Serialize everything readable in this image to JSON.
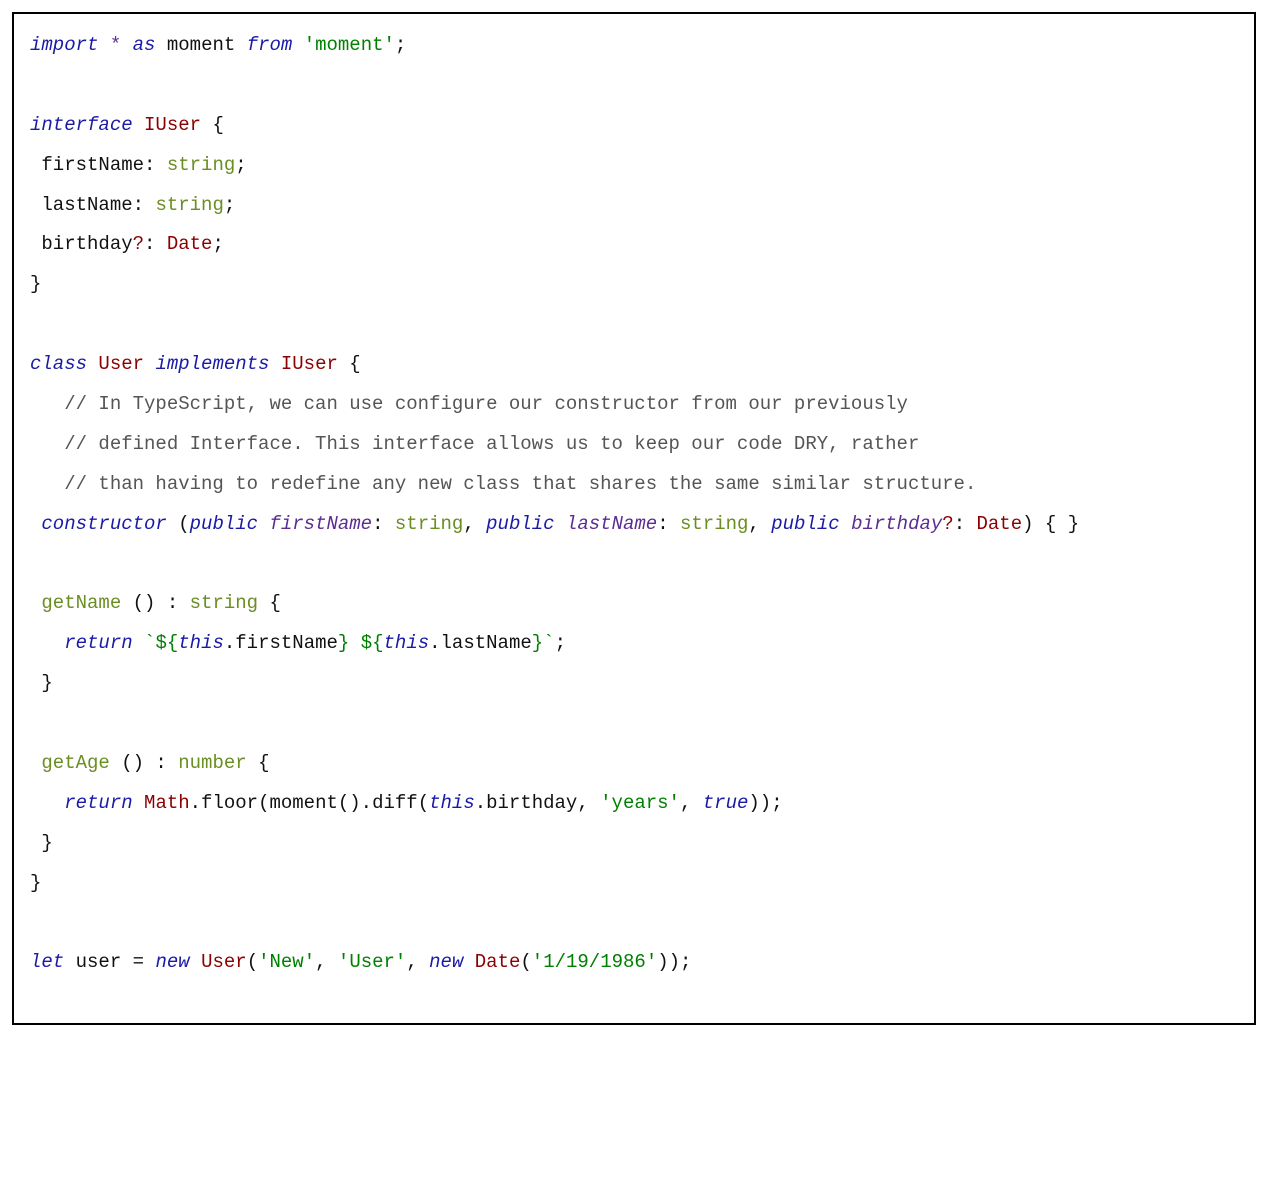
{
  "code": {
    "l1": {
      "import": "import",
      "star": "*",
      "as": "as",
      "moment": "moment",
      "from": "from",
      "str": "'moment'",
      "end": ";"
    },
    "l2": "",
    "l3": {
      "interface": "interface",
      "name": "IUser",
      "brace": " {"
    },
    "l4": {
      "indent": " ",
      "prop": "firstName",
      "colon": ": ",
      "type": "string",
      "end": ";"
    },
    "l5": {
      "indent": " ",
      "prop": "lastName",
      "colon": ": ",
      "type": "string",
      "end": ";"
    },
    "l6": {
      "indent": " ",
      "prop": "birthday",
      "q": "?",
      "colon": ": ",
      "type": "Date",
      "end": ";"
    },
    "l7": "}",
    "l8": "",
    "l9": {
      "class": "class",
      "name": "User",
      "implements": "implements",
      "iname": "IUser",
      "brace": " {"
    },
    "l10": "   // In TypeScript, we can use configure our constructor from our previously",
    "l11": "   // defined Interface. This interface allows us to keep our code DRY, rather",
    "l12": "   // than having to redefine any new class that shares the same similar structure.",
    "l13": {
      "indent": " ",
      "constructor": "constructor",
      "open": " (",
      "p1k": "public",
      "p1n": "firstName",
      "p1c": ": ",
      "p1t": "string",
      "c1": ", ",
      "p2k": "public",
      "p2n": "lastName",
      "p2c": ": ",
      "p2t": "string",
      "c2": ", ",
      "p3k": "public",
      "p3n": "birthday",
      "p3q": "?",
      "p3c": ": ",
      "p3t": "Date",
      "close": ") { }"
    },
    "l14": "",
    "l15": {
      "indent": " ",
      "name": "getName",
      "sig": " () : ",
      "type": "string",
      "brace": " {"
    },
    "l16": {
      "indent": "   ",
      "return": "return",
      "sp": " ",
      "s1": "`${",
      "e1": "this",
      "e1b": ".firstName",
      "s2": "} ${",
      "e2": "this",
      "e2b": ".lastName",
      "s3": "}`",
      "end": ";"
    },
    "l17": " }",
    "l18": "",
    "l19": {
      "indent": " ",
      "name": "getAge",
      "sig": " () : ",
      "type": "number",
      "brace": " {"
    },
    "l20": {
      "indent": "   ",
      "return": "return",
      "sp": " ",
      "math": "Math",
      "rest1": ".floor(moment().diff(",
      "this": "this",
      "rest2": ".birthday, ",
      "str": "'years'",
      "rest3": ", ",
      "true": "true",
      "rest4": "));"
    },
    "l21": " }",
    "l22": "}",
    "l23": "",
    "l24": {
      "let": "let",
      "sp": " ",
      "var": "user",
      "eq": " = ",
      "new1": "new",
      "sp2": " ",
      "cls": "User",
      "open": "(",
      "s1": "'New'",
      "c1": ", ",
      "s2": "'User'",
      "c2": ", ",
      "new2": "new",
      "sp3": " ",
      "date": "Date",
      "open2": "(",
      "s3": "'1/19/1986'",
      "close": "));"
    }
  }
}
